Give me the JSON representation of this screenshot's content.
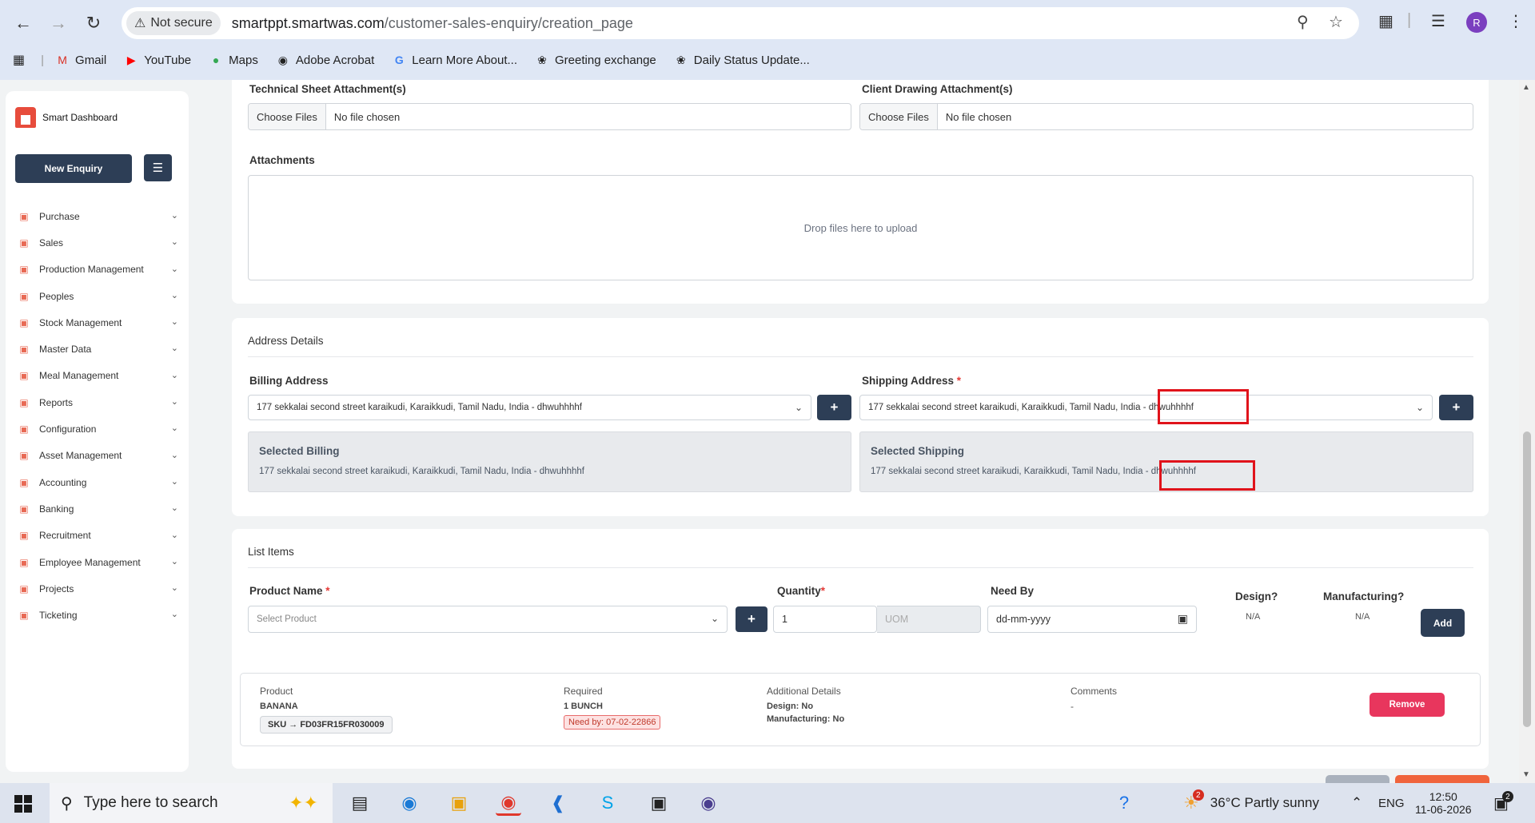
{
  "browser": {
    "security_label": "Not secure",
    "url_host": "smartppt.smartwas.com",
    "url_path": "/customer-sales-enquiry/creation_page",
    "profile_initial": "R",
    "bookmarks": [
      "Gmail",
      "YouTube",
      "Maps",
      "Adobe Acrobat",
      "Learn More About...",
      "Greeting exchange",
      "Daily Status Update..."
    ]
  },
  "sidebar": {
    "brand": "Smart Dashboard",
    "new_enquiry": "New Enquiry",
    "items": [
      "Purchase",
      "Sales",
      "Production Management",
      "Peoples",
      "Stock Management",
      "Master Data",
      "Meal Management",
      "Reports",
      "Configuration",
      "Asset Management",
      "Accounting",
      "Banking",
      "Recruitment",
      "Employee Management",
      "Projects",
      "Ticketing"
    ]
  },
  "attachments": {
    "technical_label": "Technical Sheet Attachment(s)",
    "client_label": "Client Drawing Attachment(s)",
    "choose_files": "Choose Files",
    "no_file": "No file chosen",
    "attachments_label": "Attachments",
    "drop_text": "Drop files here to upload"
  },
  "address": {
    "section_title": "Address Details",
    "billing_label": "Billing Address",
    "shipping_label": "Shipping Address",
    "required_mark": "*",
    "billing_value": "177 sekkalai second street karaikudi, Karaikkudi, Tamil Nadu, India - dhwuhhhhf",
    "shipping_value": "177 sekkalai second street karaikudi, Karaikkudi, Tamil Nadu, India - dhwuhhhhf",
    "selected_billing_title": "Selected Billing",
    "selected_billing_value": "177 sekkalai second street karaikudi, Karaikkudi, Tamil Nadu, India - dhwuhhhhf",
    "selected_shipping_title": "Selected Shipping",
    "selected_shipping_value": "177 sekkalai second street karaikudi, Karaikkudi, Tamil Nadu, India - dhwuhhhhf",
    "plus": "+"
  },
  "list_items": {
    "section_title": "List Items",
    "product_label": "Product Name",
    "product_placeholder": "Select Product",
    "quantity_label": "Quantity",
    "quantity_value": "1",
    "uom_placeholder": "UOM",
    "need_by_label": "Need By",
    "need_by_placeholder": "dd-mm-yyyy",
    "design_label": "Design?",
    "design_value": "N/A",
    "manufacturing_label": "Manufacturing?",
    "manufacturing_value": "N/A",
    "add_button": "Add",
    "item": {
      "product_header": "Product",
      "product_name": "BANANA",
      "sku": "SKU → FD03FR15FR030009",
      "required_header": "Required",
      "required_value": "1 BUNCH",
      "need_by": "Need by: 07-02-22866",
      "additional_header": "Additional Details",
      "design_line": "Design: No",
      "manufacturing_line": "Manufacturing: No",
      "comments_header": "Comments",
      "comments_value": "-",
      "remove_button": "Remove"
    }
  },
  "taskbar": {
    "search_placeholder": "Type here to search",
    "weather": "36°C  Partly sunny",
    "weather_badge": "2",
    "language": "ENG",
    "time": "12:50",
    "date": "11-06-2026",
    "notif_count": "2"
  }
}
